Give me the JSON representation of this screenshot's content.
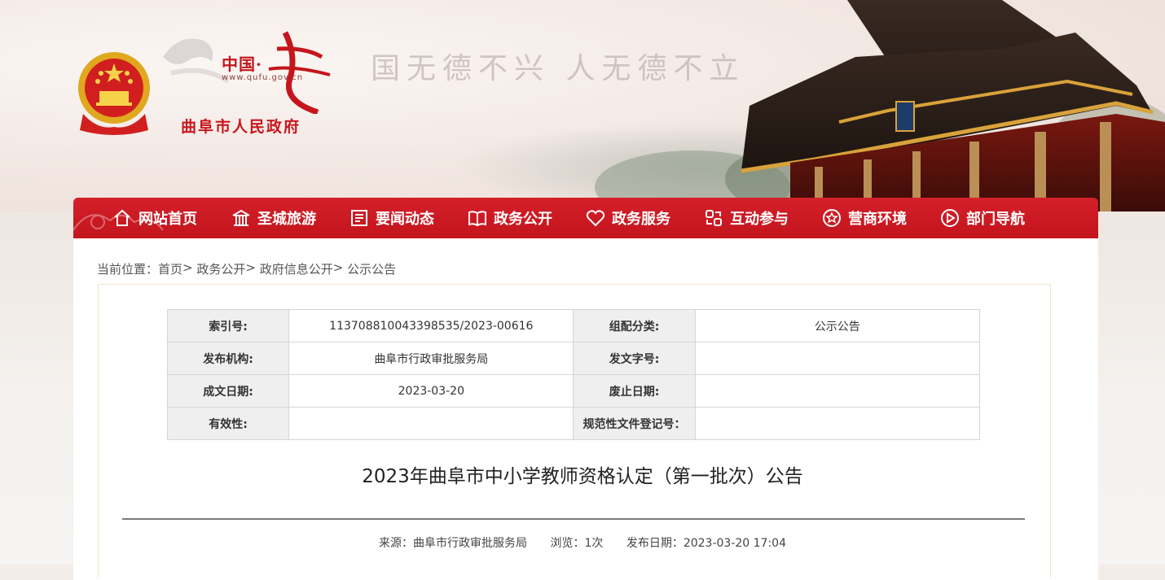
{
  "header": {
    "site_cn": "中国·",
    "site_url": "www.qufu.gov.cn",
    "site_name": "曲阜市人民政府",
    "slogan": "国无德不兴 人无德不立"
  },
  "nav": [
    {
      "label": "网站首页",
      "icon": "home-icon"
    },
    {
      "label": "圣城旅游",
      "icon": "temple-icon"
    },
    {
      "label": "要闻动态",
      "icon": "news-icon"
    },
    {
      "label": "政务公开",
      "icon": "book-icon"
    },
    {
      "label": "政务服务",
      "icon": "heart-icon"
    },
    {
      "label": "互动参与",
      "icon": "exchange-icon"
    },
    {
      "label": "营商环境",
      "icon": "star-icon"
    },
    {
      "label": "部门导航",
      "icon": "compass-icon"
    }
  ],
  "breadcrumb": {
    "prefix": "当前位置：",
    "items": [
      "首页",
      "政务公开",
      "政府信息公开",
      "公示公告"
    ],
    "sep": ">"
  },
  "meta": {
    "index_label": "索引号:",
    "index_value": "11370881004339853 5/2023-00616",
    "category_label": "组配分类:",
    "category_value": "公示公告",
    "publisher_label": "发布机构:",
    "publisher_value": "曲阜市行政审批服务局",
    "doc_no_label": "发文字号:",
    "doc_no_value": "",
    "date_label": "成文日期:",
    "date_value": "2023-03-20",
    "expire_label": "废止日期:",
    "expire_value": "",
    "validity_label": "有效性:",
    "validity_value": "",
    "reg_label": "规范性文件登记号：",
    "reg_value": ""
  },
  "article": {
    "title": "2023年曲阜市中小学教师资格认定（第一批次）公告",
    "source": "来源：曲阜市行政审批服务局",
    "views": "浏览：1次",
    "published": "发布日期：2023-03-20 17:04"
  },
  "colors": {
    "nav_red": "#c8161d",
    "accent": "#c4161c"
  }
}
